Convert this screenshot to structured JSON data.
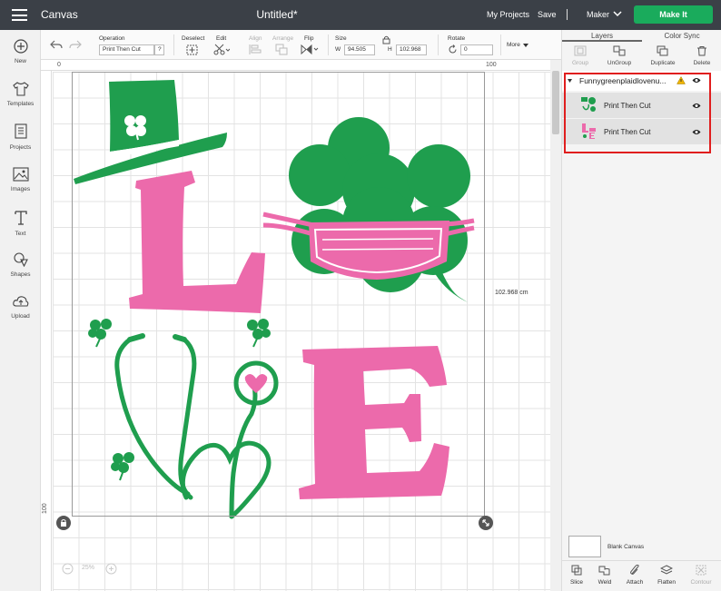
{
  "topbar": {
    "app_title": "Canvas",
    "doc_title": "Untitled*",
    "my_projects": "My Projects",
    "save": "Save",
    "machine": "Maker",
    "make_it": "Make It"
  },
  "sidebar": {
    "items": [
      {
        "label": "New",
        "icon": "plus-icon"
      },
      {
        "label": "Templates",
        "icon": "shirt-icon"
      },
      {
        "label": "Projects",
        "icon": "projects-icon"
      },
      {
        "label": "Images",
        "icon": "image-icon"
      },
      {
        "label": "Text",
        "icon": "text-icon"
      },
      {
        "label": "Shapes",
        "icon": "shapes-icon"
      },
      {
        "label": "Upload",
        "icon": "upload-icon"
      }
    ]
  },
  "toolbar": {
    "operation_label": "Operation",
    "operation_value": "Print Then Cut",
    "help": "?",
    "deselect": "Deselect",
    "edit": "Edit",
    "align": "Align",
    "arrange": "Arrange",
    "flip": "Flip",
    "size": "Size",
    "w_label": "W",
    "width": "94.505",
    "h_label": "H",
    "height": "102.968",
    "rotate": "Rotate",
    "rotate_value": "0",
    "more": "More"
  },
  "canvas": {
    "ruler_top_0": "0",
    "ruler_top_100": "100",
    "ruler_left_100": "100",
    "dimension_label": "102.968 cm",
    "zoom": "25%",
    "zoom_minus": "−",
    "zoom_plus": "+"
  },
  "rightpanel": {
    "tabs": [
      "Layers",
      "Color Sync"
    ],
    "actions": [
      {
        "label": "Group",
        "disabled": true
      },
      {
        "label": "UnGroup",
        "disabled": false
      },
      {
        "label": "Duplicate",
        "disabled": false
      },
      {
        "label": "Delete",
        "disabled": false
      }
    ],
    "group_name": "Funnygreenplaidlovenu...",
    "layers": [
      {
        "name": "Print Then Cut"
      },
      {
        "name": "Print Then Cut"
      }
    ],
    "blank_canvas": "Blank Canvas",
    "bottom_actions": [
      {
        "label": "Slice",
        "disabled": false
      },
      {
        "label": "Weld",
        "disabled": false
      },
      {
        "label": "Attach",
        "disabled": false
      },
      {
        "label": "Flatten",
        "disabled": false
      },
      {
        "label": "Contour",
        "disabled": true
      }
    ]
  },
  "colors": {
    "green": "#1f9e4e",
    "pink": "#ec6aab",
    "topbar": "#3b4047",
    "make_it": "#1aab5c",
    "highlight": "#e01e1e"
  }
}
